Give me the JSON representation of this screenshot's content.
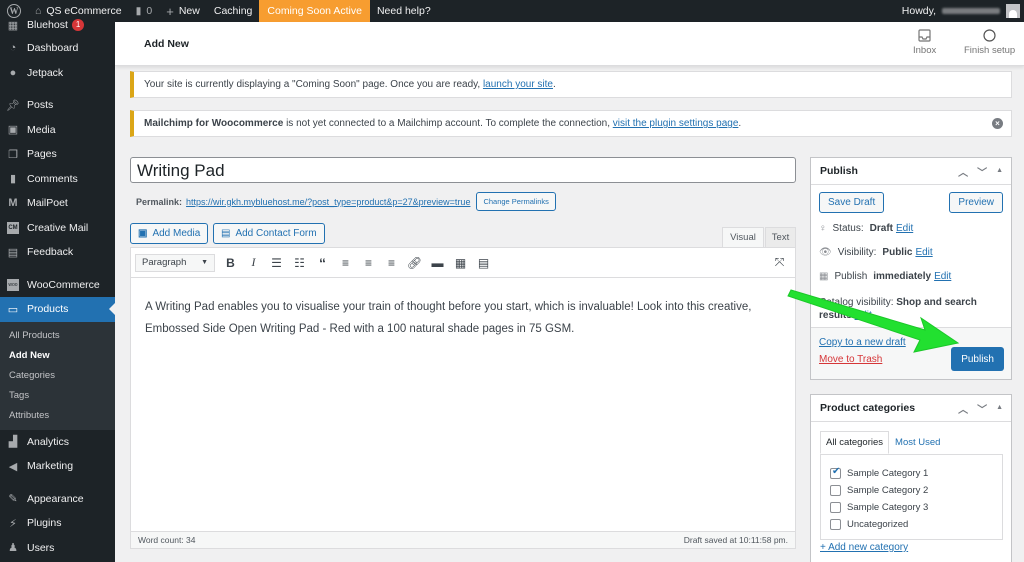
{
  "admin_bar": {
    "site_name": "QS eCommerce",
    "comments_count": "0",
    "new_label": "New",
    "caching_label": "Caching",
    "coming_soon_label": "Coming Soon Active",
    "help_label": "Need help?",
    "howdy_label": "Howdy,"
  },
  "sidebar": {
    "items": [
      {
        "label": "Bluehost",
        "icon": "grid-icon",
        "badge": "1"
      },
      {
        "label": "Dashboard",
        "icon": "dashboard-icon"
      },
      {
        "label": "Jetpack",
        "icon": "jetpack-icon"
      },
      {
        "label": "Posts",
        "icon": "pin-icon"
      },
      {
        "label": "Media",
        "icon": "media-icon"
      },
      {
        "label": "Pages",
        "icon": "pages-icon"
      },
      {
        "label": "Comments",
        "icon": "comment-icon"
      },
      {
        "label": "MailPoet",
        "icon": "mailpoet-icon"
      },
      {
        "label": "Creative Mail",
        "icon": "creative-mail-icon"
      },
      {
        "label": "Feedback",
        "icon": "feedback-icon"
      },
      {
        "label": "WooCommerce",
        "icon": "woocommerce-icon"
      },
      {
        "label": "Products",
        "icon": "archive-icon"
      },
      {
        "label": "Analytics",
        "icon": "bar-chart-icon"
      },
      {
        "label": "Marketing",
        "icon": "megaphone-icon"
      },
      {
        "label": "Appearance",
        "icon": "brush-icon"
      },
      {
        "label": "Plugins",
        "icon": "plug-icon"
      },
      {
        "label": "Users",
        "icon": "user-icon"
      }
    ],
    "submenu": [
      "All Products",
      "Add New",
      "Categories",
      "Tags",
      "Attributes"
    ]
  },
  "header": {
    "title": "Add New",
    "inbox_label": "Inbox",
    "finish_setup_label": "Finish setup"
  },
  "notices": {
    "coming_soon_text": "Your site is currently displaying a \"Coming Soon\" page. Once you are ready, ",
    "coming_soon_link": "launch your site",
    "mailchimp_bold": "Mailchimp for Woocommerce",
    "mailchimp_text": " is not yet connected to a Mailchimp account. To complete the connection, ",
    "mailchimp_link": "visit the plugin settings page"
  },
  "editor": {
    "title_value": "Writing Pad",
    "permalink_label": "Permalink:",
    "permalink_url": "https://wir.gkh.mybluehost.me/?post_type=product&p=27&preview=true",
    "change_permalinks_label": "Change Permalinks",
    "add_media_label": "Add Media",
    "add_contact_form_label": "Add Contact Form",
    "tab_visual": "Visual",
    "tab_text": "Text",
    "format_select": "Paragraph",
    "content": "A Writing Pad enables you to visualise your train of thought before you start, which is invaluable! Look into this creative, Embossed Side Open Writing Pad - Red with a 100 natural shade pages in 75 GSM.",
    "word_count": "Word count: 34",
    "draft_saved": "Draft saved at 10:11:58 pm."
  },
  "publish_box": {
    "title": "Publish",
    "save_draft_label": "Save Draft",
    "preview_label": "Preview",
    "status_label": "Status:",
    "status_value": "Draft",
    "visibility_label": "Visibility:",
    "visibility_value": "Public",
    "publish_label": "Publish",
    "publish_value": "immediately",
    "catalog_label": "Catalog visibility:",
    "catalog_value": "Shop and search results",
    "edit_label": "Edit",
    "copy_draft_label": "Copy to a new draft",
    "trash_label": "Move to Trash",
    "publish_button_label": "Publish"
  },
  "categories_box": {
    "title": "Product categories",
    "tab_all": "All categories",
    "tab_most_used": "Most Used",
    "items": [
      {
        "label": "Sample Category 1",
        "checked": true
      },
      {
        "label": "Sample Category 2",
        "checked": false
      },
      {
        "label": "Sample Category 3",
        "checked": false
      },
      {
        "label": "Uncategorized",
        "checked": false
      }
    ],
    "add_new_label": "+ Add new category"
  },
  "colors": {
    "accent": "#2271b1",
    "admin_bar": "#1d2327",
    "coming_soon": "#f79d30",
    "notice_border": "#dba617",
    "annotation_arrow": "#22e030"
  }
}
